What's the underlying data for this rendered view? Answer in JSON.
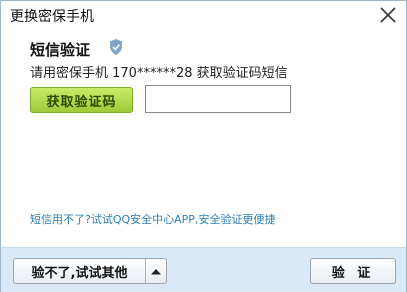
{
  "window": {
    "title": "更换密保手机",
    "close_icon": "close-icon"
  },
  "main": {
    "heading": "短信验证",
    "shield_icon": "shield-icon",
    "description": "请用密保手机 170******28 获取验证码短信",
    "get_code_label": "获取验证码",
    "code_input_value": "",
    "tip_link": "短信用不了?试试QQ安全中心APP,安全验证更便捷"
  },
  "footer": {
    "alt_button_label": "验不了,试试其他",
    "alt_arrow_icon": "triangle-up-icon",
    "confirm_label": "验 证"
  },
  "colors": {
    "accent_green": "#9ecb38",
    "link_blue": "#2f7fb5",
    "footer_bg": "#d9e9f7"
  }
}
